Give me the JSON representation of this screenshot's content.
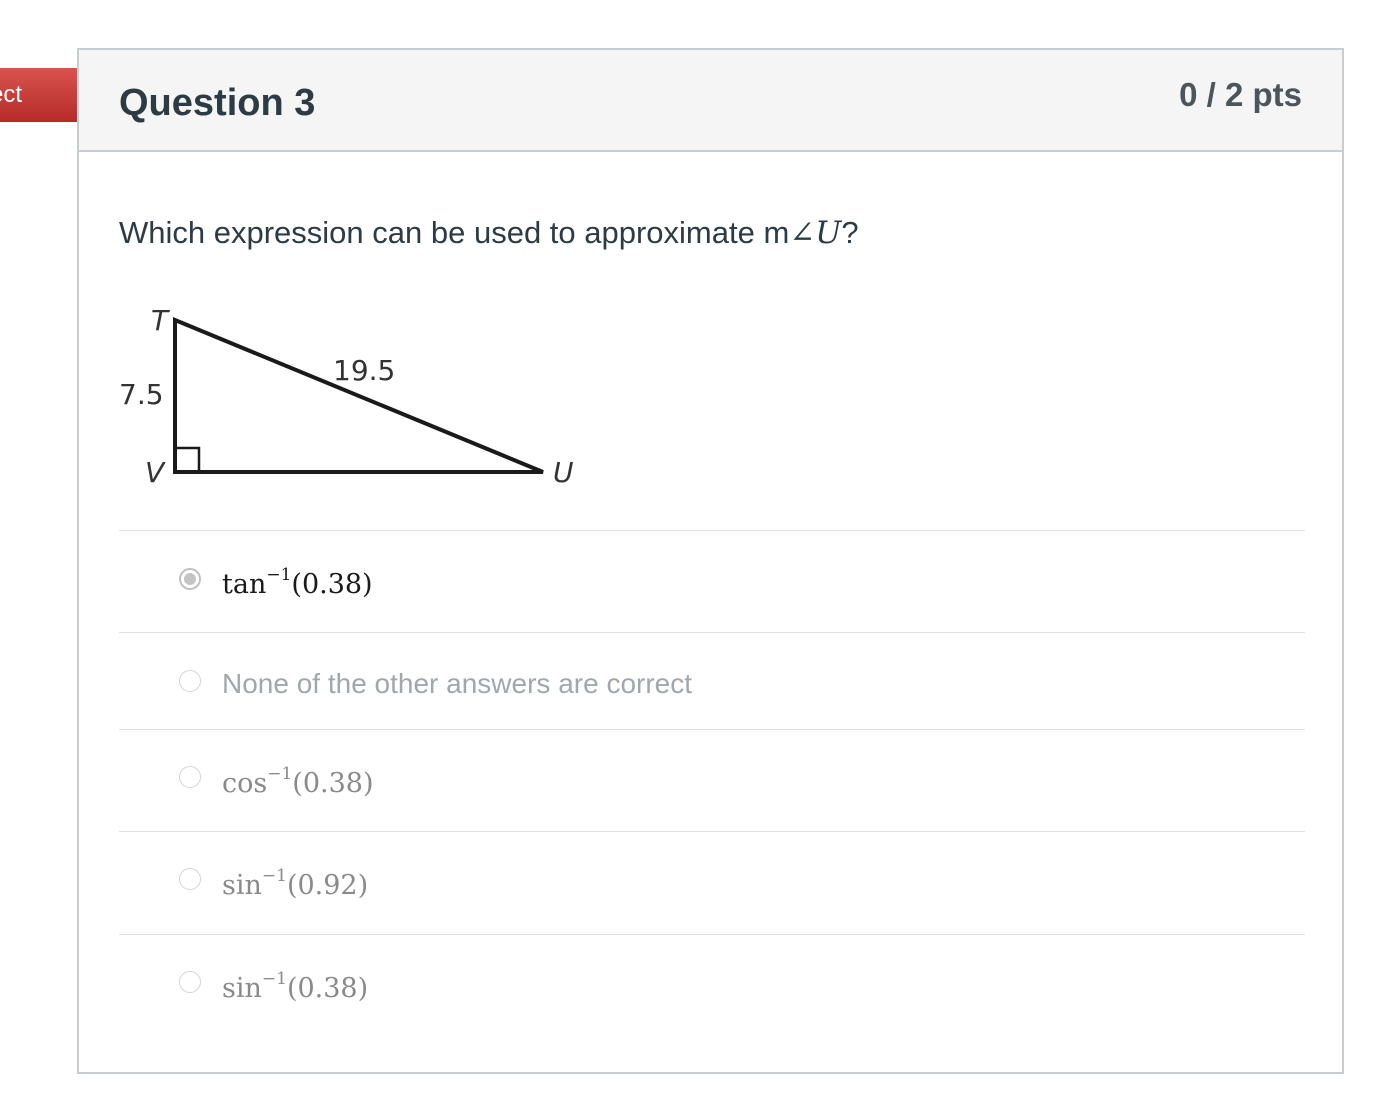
{
  "flag": {
    "label": "ect",
    "color": "#c9302c"
  },
  "question": {
    "title": "Question 3",
    "points": "0 / 2 pts",
    "prompt_prefix": "Which expression can be used to approximate m",
    "prompt_angle": "∠U",
    "prompt_suffix": "?"
  },
  "figure": {
    "vertex_t": "T",
    "vertex_v": "V",
    "vertex_u": "U",
    "side_tv": "7.5",
    "side_tu": "19.5"
  },
  "answers": [
    {
      "func": "tan",
      "exp": "−1",
      "arg": "(0.38)",
      "selected": true
    },
    {
      "text": "None of the other answers are correct",
      "selected": false
    },
    {
      "func": "cos",
      "exp": "−1",
      "arg": "(0.38)",
      "selected": false
    },
    {
      "func": "sin",
      "exp": "−1",
      "arg": "(0.92)",
      "selected": false
    },
    {
      "func": "sin",
      "exp": "−1",
      "arg": "(0.38)",
      "selected": false
    }
  ]
}
